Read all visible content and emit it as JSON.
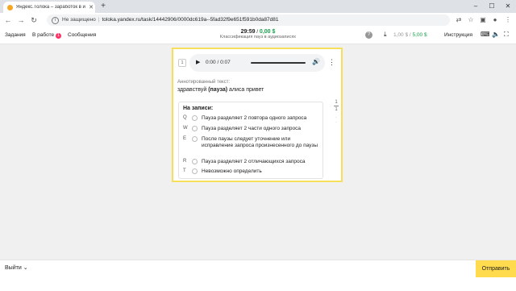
{
  "browser": {
    "tab_title": "Яндекс.Толока – заработок в и",
    "tab_close": "✕",
    "new_tab": "+",
    "window_controls": [
      "–",
      "☐",
      "✕"
    ],
    "security_label": "Не защищено",
    "url": "toloka.yandex.ru/task/14442906/0000dc619a--5fad32f9e651f591b0da87d81"
  },
  "header": {
    "menu": {
      "tasks": "Задания",
      "in_progress": "В работе",
      "in_progress_count": "1",
      "messages": "Сообщения"
    },
    "timer": "29:59",
    "reward": "0,00 $",
    "project": "Классификация пауз в аудиозаписях",
    "help": "?",
    "balance_left": "1,00 $",
    "balance_sep": " / ",
    "balance_right": "5,00 $",
    "instruction": "Инструкция"
  },
  "task": {
    "row_number": "1",
    "audio": {
      "time": "0:00 / 0:07"
    },
    "annotated_label": "Аннотированный текст:",
    "text_before": "здравствуй ",
    "pause_token": "(пауза)",
    "text_after": " алиса привет",
    "question_title": "На записи:",
    "options": [
      {
        "key": "Q",
        "label": "Пауза разделяет 2 повтора одного запроса"
      },
      {
        "key": "W",
        "label": "Пауза разделяет 2 части одного запроса"
      },
      {
        "key": "E",
        "label": "После паузы следует уточнение или исправление запроса произнесенного до паузы"
      },
      {
        "key": "R",
        "label": "Пауза разделяет 2 отличающихся запроса"
      },
      {
        "key": "T",
        "label": "Невозможно определить"
      }
    ]
  },
  "pager": {
    "current": "1",
    "total": "1"
  },
  "footer": {
    "exit": "Выйти",
    "submit": "Отправить"
  }
}
